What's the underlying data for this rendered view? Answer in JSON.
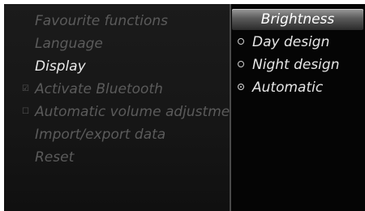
{
  "left_menu": {
    "items": [
      {
        "label": "Favourite functions",
        "active": false,
        "checkbox": null
      },
      {
        "label": "Language",
        "active": false,
        "checkbox": null
      },
      {
        "label": "Display",
        "active": true,
        "checkbox": null
      },
      {
        "label": "Activate Bluetooth",
        "active": false,
        "checkbox": "checked"
      },
      {
        "label": "Automatic volume adjustment",
        "active": false,
        "checkbox": "unchecked"
      },
      {
        "label": "Import/export data",
        "active": false,
        "checkbox": null
      },
      {
        "label": "Reset",
        "active": false,
        "checkbox": null
      }
    ],
    "checkbox_glyphs": {
      "checked": "☑",
      "unchecked": "☐"
    }
  },
  "right_menu": {
    "header": "Brightness",
    "options": [
      {
        "label": "Day design",
        "selected": false
      },
      {
        "label": "Night design",
        "selected": false
      },
      {
        "label": "Automatic",
        "selected": true
      }
    ]
  }
}
